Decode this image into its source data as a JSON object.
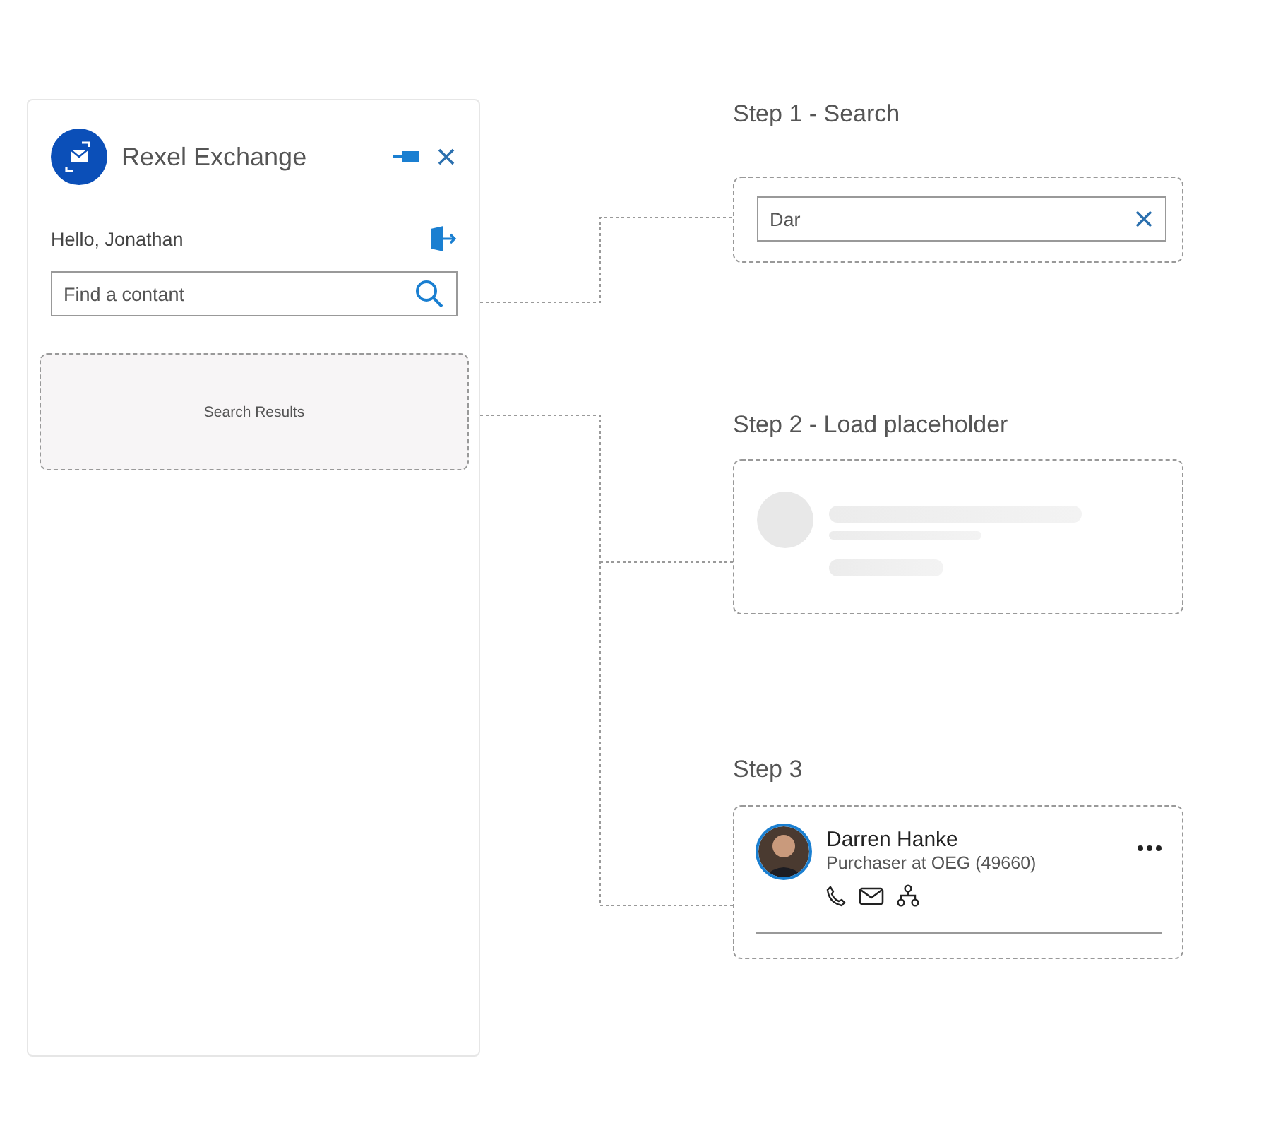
{
  "panel": {
    "title": "Rexel Exchange",
    "greeting": "Hello, Jonathan",
    "search": {
      "placeholder": "Find a contant"
    },
    "results_label": "Search Results"
  },
  "steps": [
    {
      "kind": "search",
      "title": "Step 1 - Search",
      "value": "Dar"
    },
    {
      "kind": "placeholder",
      "title": "Step 2 - Load placeholder"
    },
    {
      "kind": "contact",
      "title": "Step 3",
      "name": "Darren Hanke",
      "role": "Purchaser at OEG (49660)"
    }
  ]
}
